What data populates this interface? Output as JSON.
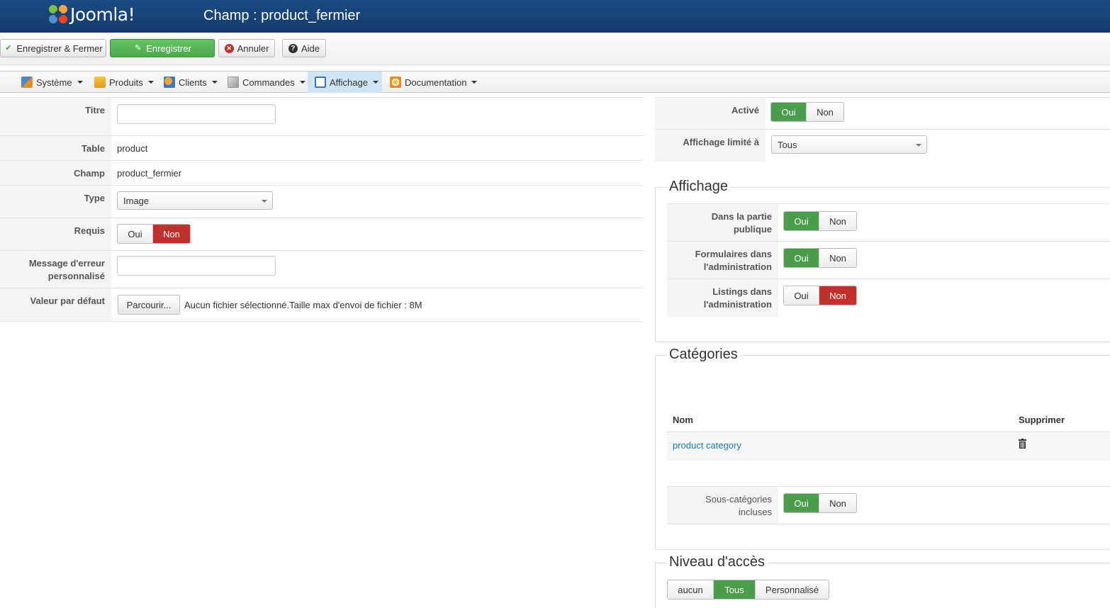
{
  "header": {
    "logo_text": "Joomla!",
    "page_title": "Champ : product_fermier"
  },
  "toolbar": {
    "save_close": "Enregistrer & Fermer",
    "save": "Enregistrer",
    "cancel": "Annuler",
    "help": "Aide"
  },
  "menu": {
    "items": [
      {
        "label": "Système",
        "icon": "tools-icon"
      },
      {
        "label": "Produits",
        "icon": "products-icon"
      },
      {
        "label": "Clients",
        "icon": "users-icon"
      },
      {
        "label": "Commandes",
        "icon": "orders-icon"
      },
      {
        "label": "Affichage",
        "icon": "display-icon"
      },
      {
        "label": "Documentation",
        "icon": "documentation-icon"
      }
    ],
    "active": "Affichage"
  },
  "form": {
    "titre_label": "Titre",
    "titre_value": "",
    "table_label": "Table",
    "table_value": "product",
    "champ_label": "Champ",
    "champ_value": "product_fermier",
    "type_label": "Type",
    "type_value": "Image",
    "requis_label": "Requis",
    "requis_yes": "Oui",
    "requis_no": "Non",
    "requis_selected": "Non",
    "error_msg_label_1": "Message d'erreur",
    "error_msg_label_2": "personnalisé",
    "error_msg_value": "",
    "default_label": "Valeur par défaut",
    "browse_button": "Parcourir...",
    "no_file": "Aucun fichier sélectionné.",
    "max_size": "Taille max d'envoi de fichier : 8M"
  },
  "right": {
    "active_label": "Activé",
    "active_yes": "Oui",
    "active_no": "Non",
    "active_selected": "Oui",
    "limit_label": "Affichage limité à",
    "limit_value": "Tous",
    "affichage": {
      "legend": "Affichage",
      "public_label_1": "Dans la partie",
      "public_label_2": "publique",
      "public_selected": "Oui",
      "forms_label_1": "Formulaires dans",
      "forms_label_2": "l'administration",
      "forms_selected": "Oui",
      "listings_label_1": "Listings dans",
      "listings_label_2": "l'administration",
      "listings_selected": "Non",
      "yes": "Oui",
      "no": "Non"
    },
    "categories": {
      "legend": "Catégories",
      "col_name": "Nom",
      "col_delete": "Supprimer",
      "rows": [
        {
          "name": "product category"
        }
      ],
      "sub_label_1": "Sous-catégories",
      "sub_label_2": "incluses",
      "sub_selected": "Oui",
      "yes": "Oui",
      "no": "Non"
    },
    "access": {
      "legend": "Niveau d'accès",
      "options": [
        "aucun",
        "Tous",
        "Personnalisé"
      ],
      "selected": "Tous"
    }
  },
  "colors": {
    "header_bg": "#1a4478",
    "green": "#4a9d4a",
    "red": "#c0302c",
    "link": "#1e78b4"
  }
}
